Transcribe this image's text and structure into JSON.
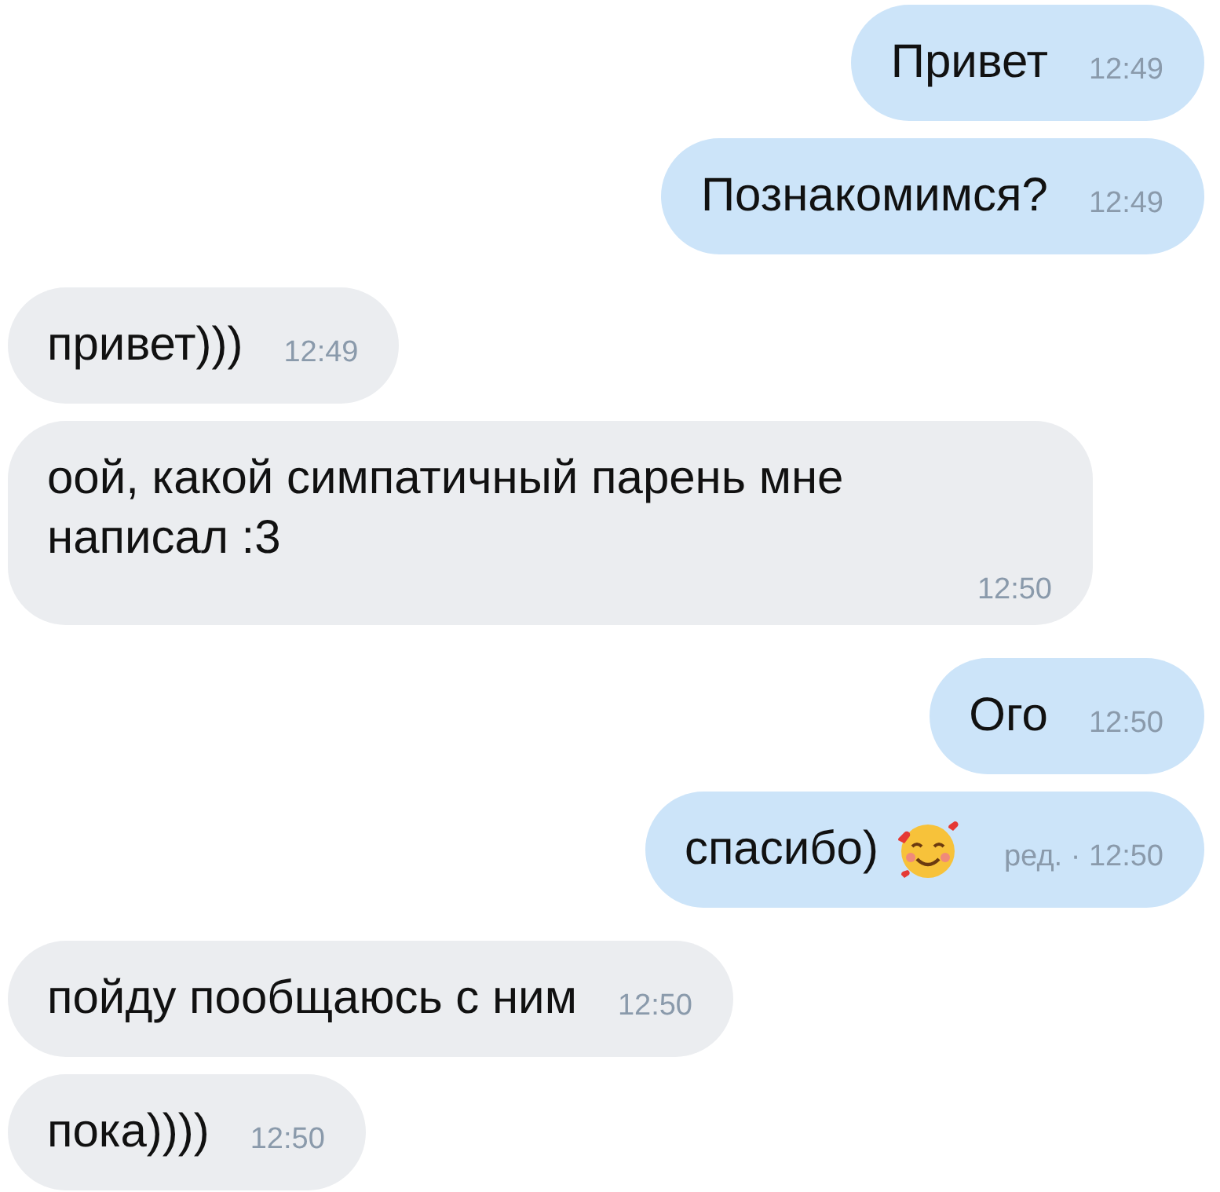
{
  "messages": [
    {
      "kind": "outgoing",
      "text": "Привет",
      "time": "12:49",
      "has_emoji": false
    },
    {
      "kind": "outgoing",
      "text": "Познакомимся?",
      "time": "12:49",
      "has_emoji": false
    },
    {
      "kind": "incoming",
      "text": "привет)))",
      "time": "12:49",
      "has_emoji": false
    },
    {
      "kind": "incoming",
      "text": "оой, какой симпатичный парень мне написал :3",
      "time": "12:50",
      "has_emoji": false
    },
    {
      "kind": "outgoing",
      "text": "Ого",
      "time": "12:50",
      "has_emoji": false
    },
    {
      "kind": "outgoing",
      "text": "спасибо)",
      "time": "ред. · 12:50",
      "has_emoji": true
    },
    {
      "kind": "incoming",
      "text": "пойду пообщаюсь с ним",
      "time": "12:50",
      "has_emoji": false
    },
    {
      "kind": "incoming",
      "text": "пока))))",
      "time": "12:50",
      "has_emoji": false
    }
  ]
}
